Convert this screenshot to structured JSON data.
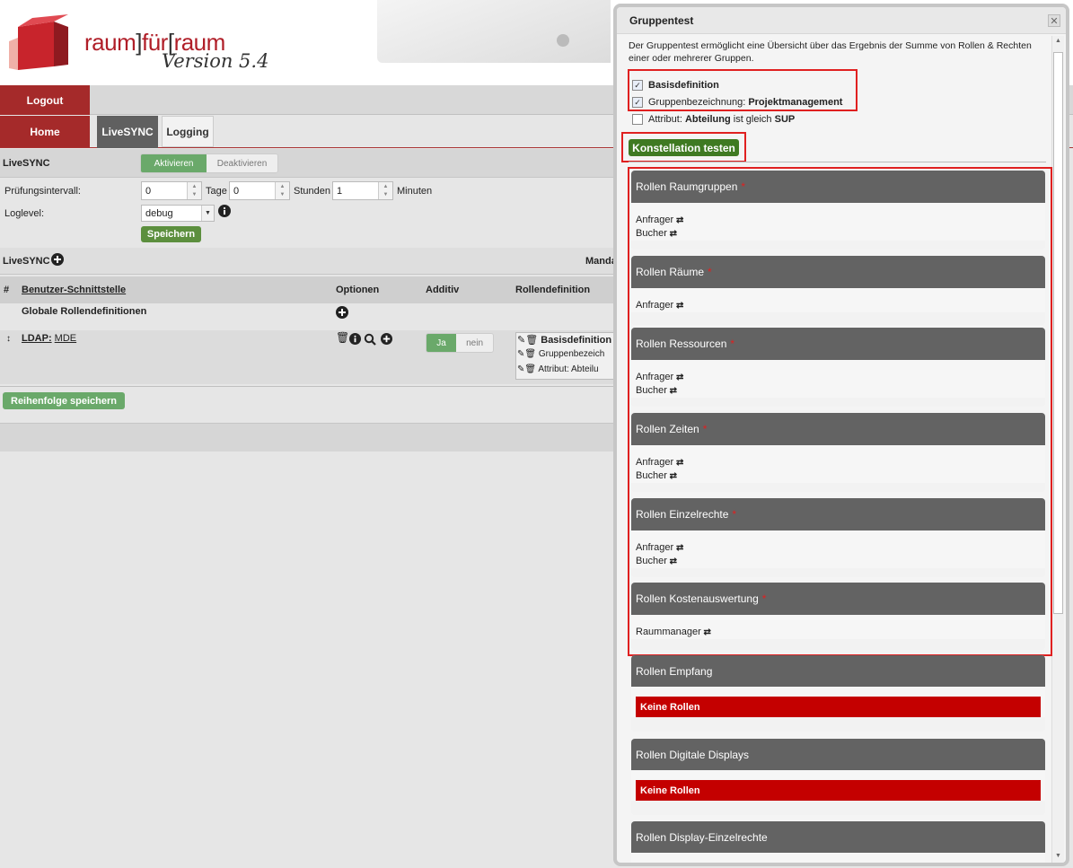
{
  "header": {
    "brand_part1": "raum",
    "brand_bracket1": "]",
    "brand_part2": "für",
    "brand_bracket2": "[",
    "brand_part3": "raum",
    "version": "Version 5.4"
  },
  "nav": {
    "logout": "Logout",
    "home": "Home",
    "tabs": [
      "LiveSYNC",
      "Logging"
    ]
  },
  "livesync": {
    "title": "LiveSYNC",
    "activate": "Aktivieren",
    "deactivate": "Deaktivieren",
    "interval_label": "Prüfungsintervall:",
    "days_value": "0",
    "days_unit": "Tage",
    "hours_value": "0",
    "hours_unit": "Stunden",
    "minutes_value": "1",
    "minutes_unit": "Minuten",
    "loglevel_label": "Loglevel:",
    "loglevel_value": "debug",
    "save": "Speichern"
  },
  "list": {
    "title": "LiveSYNC",
    "mandant_fragment": "Manda",
    "columns": [
      "#",
      "Benutzer-Schnittstelle",
      "Optionen",
      "Additiv",
      "Rollendefinition"
    ],
    "global_row": "Globale Rollendefinitionen",
    "ldap_row": {
      "label_bold": "LDAP:",
      "label_link": "MDE",
      "toggle_on": "Ja",
      "toggle_off": "nein",
      "defs": [
        "Basisdefinition",
        "Gruppenbezeich",
        "Attribut: Abteilu"
      ]
    },
    "save_order": "Reihenfolge speichern"
  },
  "modal": {
    "title": "Gruppentest",
    "close": "✕",
    "description": "Der Gruppentest ermöglicht eine Übersicht über das Ergebnis der Summe von Rollen & Rechten einer oder mehrerer Gruppen.",
    "options": [
      {
        "text_bold": "Basisdefinition",
        "text_plain": "",
        "text_bold2": "",
        "checked": true
      },
      {
        "text_plain": "Gruppenbezeichnung: ",
        "text_bold": "Projektmanagement",
        "checked": true
      },
      {
        "text_plain": "Attribut: ",
        "text_bold": "Abteilung",
        "text_plain2": " ist gleich ",
        "text_bold2": "SUP",
        "checked": false
      }
    ],
    "test_button": "Konstellation testen",
    "role_groups": [
      {
        "title": "Rollen Raumgruppen",
        "required": "*",
        "roles": [
          "Anfrager",
          "Bucher"
        ]
      },
      {
        "title": "Rollen Räume",
        "required": "*",
        "roles": [
          "Anfrager"
        ]
      },
      {
        "title": "Rollen Ressourcen",
        "required": "*",
        "roles": [
          "Anfrager",
          "Bucher"
        ]
      },
      {
        "title": "Rollen Zeiten",
        "required": "*",
        "roles": [
          "Anfrager",
          "Bucher"
        ]
      },
      {
        "title": "Rollen Einzelrechte",
        "required": "*",
        "roles": [
          "Anfrager",
          "Bucher"
        ]
      },
      {
        "title": "Rollen Kostenauswertung",
        "required": "*",
        "roles": [
          "Raummanager"
        ]
      },
      {
        "title": "Rollen Empfang",
        "required": "",
        "no_roles": "Keine Rollen"
      },
      {
        "title": "Rollen Digitale Displays",
        "required": "",
        "no_roles": "Keine Rollen"
      },
      {
        "title": "Rollen Display-Einzelrechte",
        "required": ""
      }
    ]
  },
  "colors": {
    "brand_red": "#a52a2a",
    "accent_green": "#5c8f3e",
    "highlight_red": "#e02020",
    "no_roles_red": "#c40000"
  }
}
